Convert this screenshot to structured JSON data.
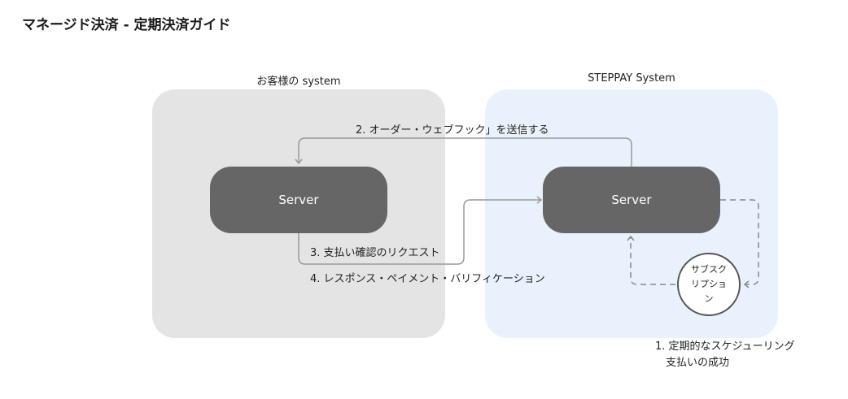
{
  "page": {
    "title": "マネージド決済 - 定期決済ガイド"
  },
  "zones": {
    "customer": {
      "label": "お客様の system",
      "color": "#e4e4e4"
    },
    "steppay": {
      "label": "STEPPAY System",
      "color": "#e9f2fc"
    }
  },
  "nodes": {
    "customer_server": "Server",
    "steppay_server": "Server",
    "subscription": "サブスクリプション"
  },
  "flows": {
    "step2": "2. オーダー・ウェブフック」を送信する",
    "step3": "3. 支払い確認のリクエスト",
    "step4": "4. レスポンス・ペイメント・バリフィケーション"
  },
  "note": {
    "line1": "1. 定期的なスケジューリング",
    "line2": "支払いの成功"
  },
  "colors": {
    "server": "#666666",
    "connector": "#999999",
    "dashed_connector": "#888888"
  }
}
